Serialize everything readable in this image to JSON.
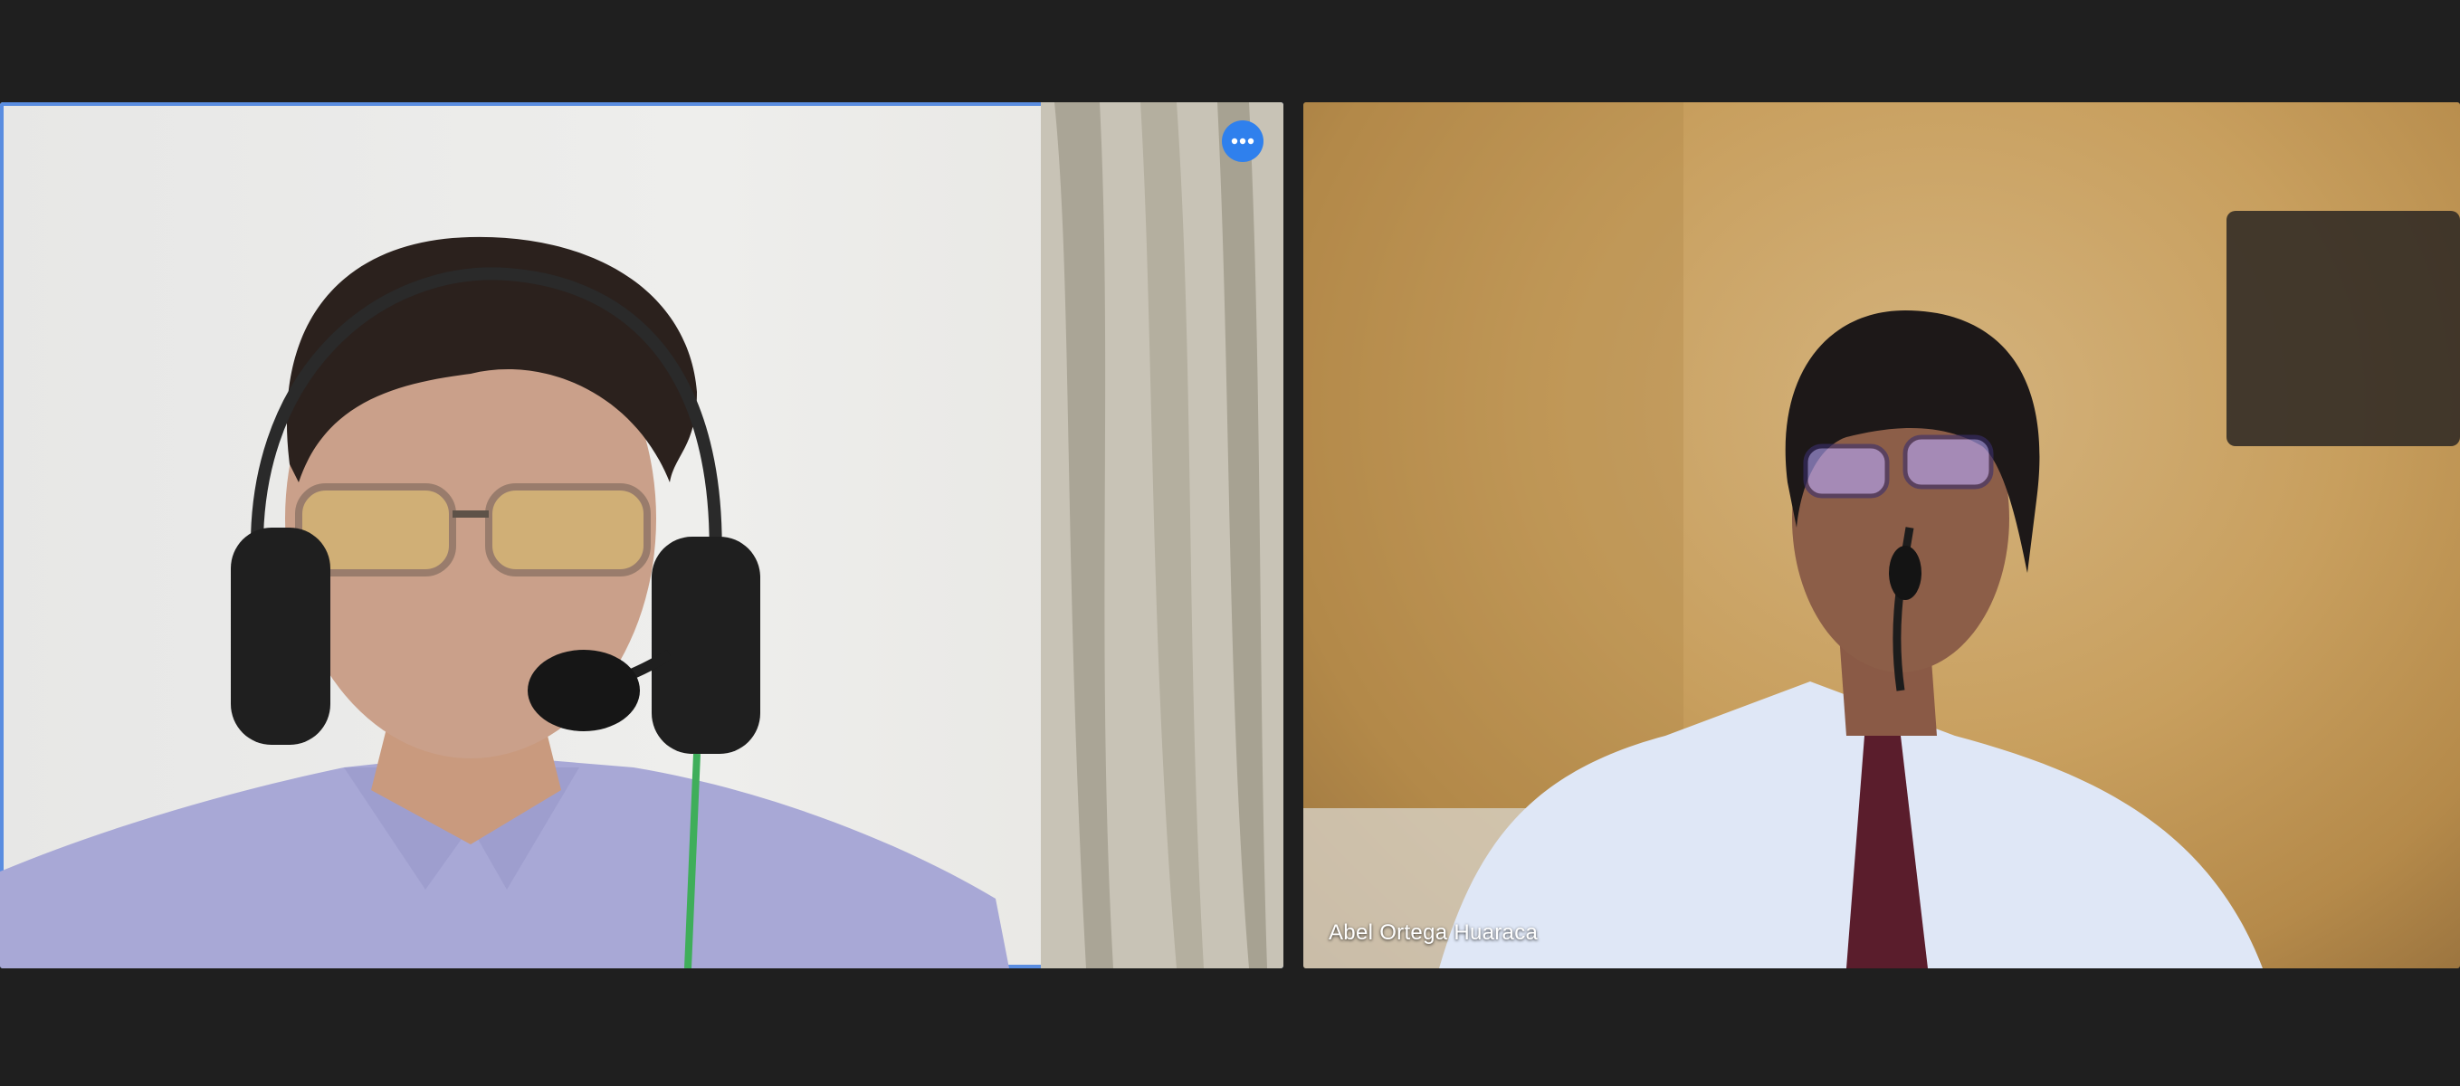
{
  "participants": [
    {
      "name": "",
      "active_speaker": true,
      "has_more_options": true,
      "more_options_icon": "ellipsis-icon"
    },
    {
      "name": "Abel Ortega Huaraca",
      "active_speaker": false,
      "has_more_options": false
    }
  ],
  "colors": {
    "background": "#1f1f1f",
    "active_border": "#5a8de0",
    "menu_button": "#2f80ed"
  }
}
